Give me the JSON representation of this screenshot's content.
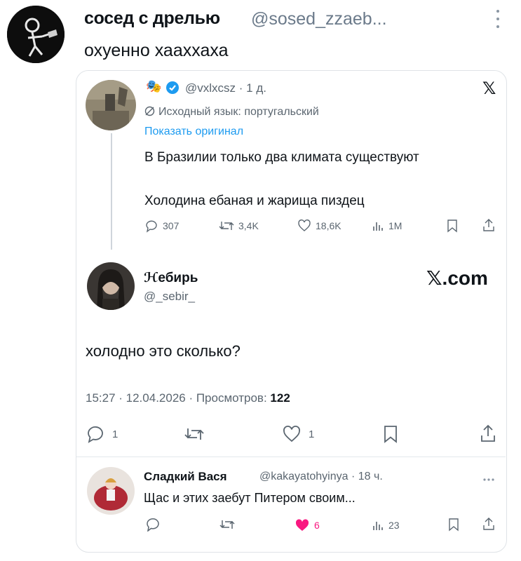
{
  "outer": {
    "name": "сосед с дрелью",
    "handle": "@sosed_zzaeb...",
    "text": "охуенно хааххаха"
  },
  "quoted": {
    "emoji": "🎭",
    "handle_time": "@vxlxcsz · 1 д.",
    "translation_note": "Исходный язык: португальский",
    "show_original": "Показать оригинал",
    "line1": "В Бразилии только два климата существуют",
    "line2": "Холодина ебаная и жарища пиздец",
    "replies": "307",
    "retweets": "3,4K",
    "likes": "18,6K",
    "views": "1M",
    "x_logo": "𝕏"
  },
  "reply": {
    "name": "ℋебирь",
    "handle": "@_sebir_",
    "site": "𝕏.com",
    "text": "холодно это сколько?",
    "meta_prefix": "15:27 · 12.04.2026 · Просмотров: ",
    "views": "122",
    "replies": "1",
    "likes": "1"
  },
  "comment": {
    "name": "Сладкий Вася",
    "handle_time": "@kakayatohyinya · 18 ч.",
    "text": "Щас и этих заебут Питером своим...",
    "likes": "6",
    "views": "23"
  },
  "colors": {
    "accent": "#1d9bf0",
    "verified": "#1d9bf0",
    "like": "#f91880",
    "muted": "#5b6670"
  }
}
